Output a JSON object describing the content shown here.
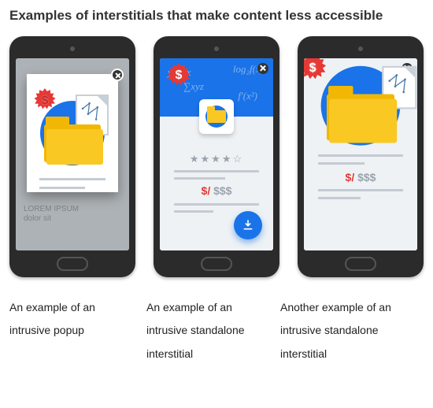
{
  "heading": "Examples of interstitials that make content less accessible",
  "phones": {
    "p1": {
      "popup_badge": "$",
      "bg_text_line1": "LOREM IPSUM",
      "bg_text_line2": "dolor sit"
    },
    "p2": {
      "badge": "$",
      "stars": "★★★★☆",
      "price_prefix": "$/",
      "price_suffix": " $$$"
    },
    "p3": {
      "badge": "$",
      "price_prefix": "$/",
      "price_suffix": " $$$"
    }
  },
  "captions": {
    "c1": "An example of an intrusive popup",
    "c2": "An example of an intrusive standalone interstitial",
    "c3": "Another example of an intrusive standalone interstitial"
  },
  "colors": {
    "accent": "#1a73e8",
    "danger": "#e53935",
    "folder": "#f9c823"
  }
}
